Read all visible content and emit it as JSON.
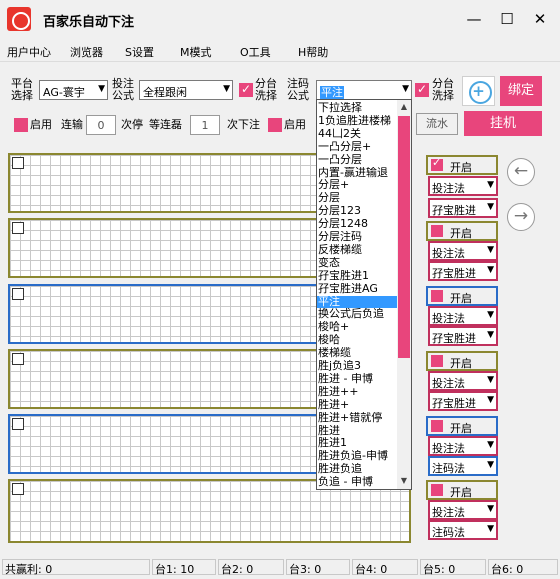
{
  "window": {
    "title": "百家乐自动下注",
    "minimize": "—",
    "maximize": "☐",
    "close": "✕"
  },
  "menu": [
    "用户中心",
    "浏览器",
    "S设置",
    "M模式",
    "O工具",
    "H帮助"
  ],
  "top": {
    "platform_label": "平台\n选择",
    "platform_value": "AG-寰宇",
    "betting_label": "投注\n公式",
    "betting_value": "全程跟闲",
    "table_wash_label": "分台\n洗择",
    "note_label": "注码\n公式",
    "note_value": "平注",
    "table_wash_label2": "分台\n洗择",
    "bind_button": "绑定",
    "hang_button": "挂机",
    "flow_button": "流水"
  },
  "row2": {
    "enable": "启用",
    "lose_streak": "连输",
    "lose_streak_value": "0",
    "times_stop": "次停",
    "wait_lose": "等连磊",
    "wait_lose_value": "1",
    "times_bet": "次下注",
    "enable2": "启用"
  },
  "dropdown_items": [
    "下拉选择",
    "1负追胜进楼梯",
    "44凵2关",
    "一凸分层+",
    "一凸分层",
    "内置-赢进输退",
    "分层+",
    "分层",
    "分层123",
    "分层1248",
    "分层注码",
    "反楼梯缆",
    "变态",
    "孖宝胜进1",
    "孖宝胜进AG",
    "平注",
    "换公式后负追",
    "梭哈+",
    "梭哈",
    "楼梯缆",
    "胜j负追3",
    "胜进 - 申博",
    "胜进++",
    "胜进+",
    "胜进+错就停",
    "胜进",
    "胜进1",
    "胜进负追-申博",
    "胜进负追",
    "负追 - 申博"
  ],
  "dropdown_selected": 15,
  "tables": [
    {
      "open": "开启",
      "checked": true,
      "dd1": "投注法",
      "dd2": "孖宝胜进"
    },
    {
      "open": "开启",
      "checked": false,
      "dd1": "投注法",
      "dd2": "孖宝胜进"
    },
    {
      "open": "开启",
      "checked": false,
      "dd1": "投注法",
      "dd2": "孖宝胜进"
    },
    {
      "open": "开启",
      "checked": false,
      "dd1": "投注法",
      "dd2": "孖宝胜进"
    },
    {
      "open": "开启",
      "checked": false,
      "dd1": "投注法",
      "dd2": "注码法"
    },
    {
      "open": "开启",
      "checked": false,
      "dd1": "投注法",
      "dd2": "注码法"
    }
  ],
  "nav": {
    "prev": "←",
    "next": "→"
  },
  "status": {
    "total": "共赢利: 0",
    "t1": "台1: 10",
    "t2": "台2: 0",
    "t3": "台3: 0",
    "t4": "台4: 0",
    "t5": "台5: 0",
    "t6": "台6: 0"
  },
  "colors": {
    "accent_pink": "#e8457c",
    "olive_border": "#8b8730",
    "blue_border": "#2a6cc8",
    "selected": "#3399ff"
  }
}
